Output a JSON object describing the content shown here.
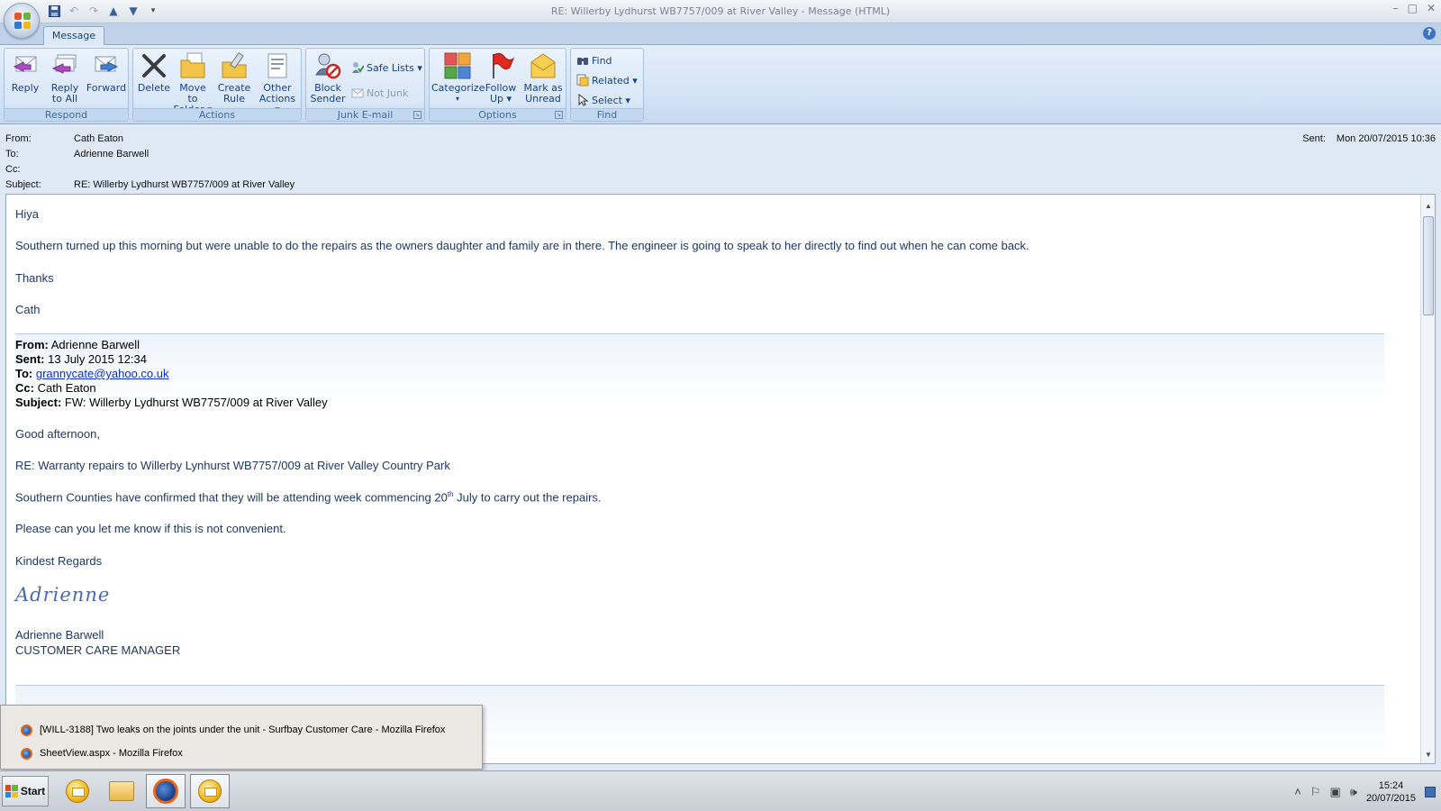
{
  "window": {
    "title": "RE: Willerby Lydhurst WB7757/009 at River Valley - Message (HTML)",
    "controls": [
      "–",
      "□",
      "✕"
    ]
  },
  "quick_access": [
    "save-icon",
    "undo-icon",
    "redo-icon",
    "previous-item-icon",
    "next-item-icon",
    "customize-icon"
  ],
  "tabs": {
    "message": "Message"
  },
  "ribbon": {
    "respond": {
      "label": "Respond",
      "reply": "Reply",
      "reply_all_1": "Reply",
      "reply_all_2": "to All",
      "forward": "Forward"
    },
    "actions": {
      "label": "Actions",
      "delete": "Delete",
      "move_1": "Move to",
      "move_2": "Folder ▾",
      "rule_1": "Create",
      "rule_2": "Rule",
      "other_1": "Other",
      "other_2": "Actions ▾"
    },
    "junk": {
      "label": "Junk E-mail",
      "block_1": "Block",
      "block_2": "Sender",
      "safe_lists": "Safe Lists ▾",
      "not_junk": "Not Junk"
    },
    "options": {
      "label": "Options",
      "categorize": "Categorize",
      "categorize_2": "▾",
      "follow_1": "Follow",
      "follow_2": "Up ▾",
      "mark_1": "Mark as",
      "mark_2": "Unread"
    },
    "find": {
      "label": "Find",
      "find": "Find",
      "related": "Related ▾",
      "select": "Select ▾"
    }
  },
  "header": {
    "from_label": "From:",
    "from": "Cath Eaton",
    "to_label": "To:",
    "to": "Adrienne Barwell",
    "cc_label": "Cc:",
    "cc": "",
    "subject_label": "Subject:",
    "subject": "RE: Willerby Lydhurst WB7757/009 at River Valley",
    "sent_label": "Sent:",
    "sent": "Mon 20/07/2015 10:36"
  },
  "body": {
    "greeting": "Hiya",
    "para1": "Southern turned up this morning but were unable to do the repairs as the owners daughter and family are in there.  The engineer is going to speak to her directly to find out when he can come back.",
    "thanks": "Thanks",
    "sign": "Cath",
    "quoted_header": {
      "from_label": "From:",
      "from": "Adrienne Barwell",
      "sent_label": "Sent:",
      "sent": "13 July 2015 12:34",
      "to_label": "To:",
      "to": "grannycate@yahoo.co.uk",
      "cc_label": "Cc:",
      "cc": "Cath Eaton",
      "subject_label": "Subject:",
      "subject": "FW: Willerby Lydhurst WB7757/009 at River Valley"
    },
    "q_greeting": "Good afternoon,",
    "q_re": "RE: Warranty repairs to Willerby Lynhurst WB7757/009 at River Valley Country Park",
    "q_para_a": "Southern Counties have confirmed that they will be attending week commencing 20",
    "q_para_sup": "th",
    "q_para_b": " July to carry out the repairs.",
    "q_para2": "Please can you let me know if this is not convenient.",
    "q_regards": "Kindest Regards",
    "q_signature": "Adrienne",
    "q_name": "Adrienne Barwell",
    "q_title": "CUSTOMER CARE MANAGER"
  },
  "popup": {
    "items": [
      "[WILL-3188] Two leaks on the joints under the unit - Surfbay Customer Care - Mozilla Firefox",
      "SheetView.aspx - Mozilla Firefox"
    ]
  },
  "taskbar": {
    "start": "Start",
    "time": "15:24",
    "date": "20/07/2015"
  }
}
